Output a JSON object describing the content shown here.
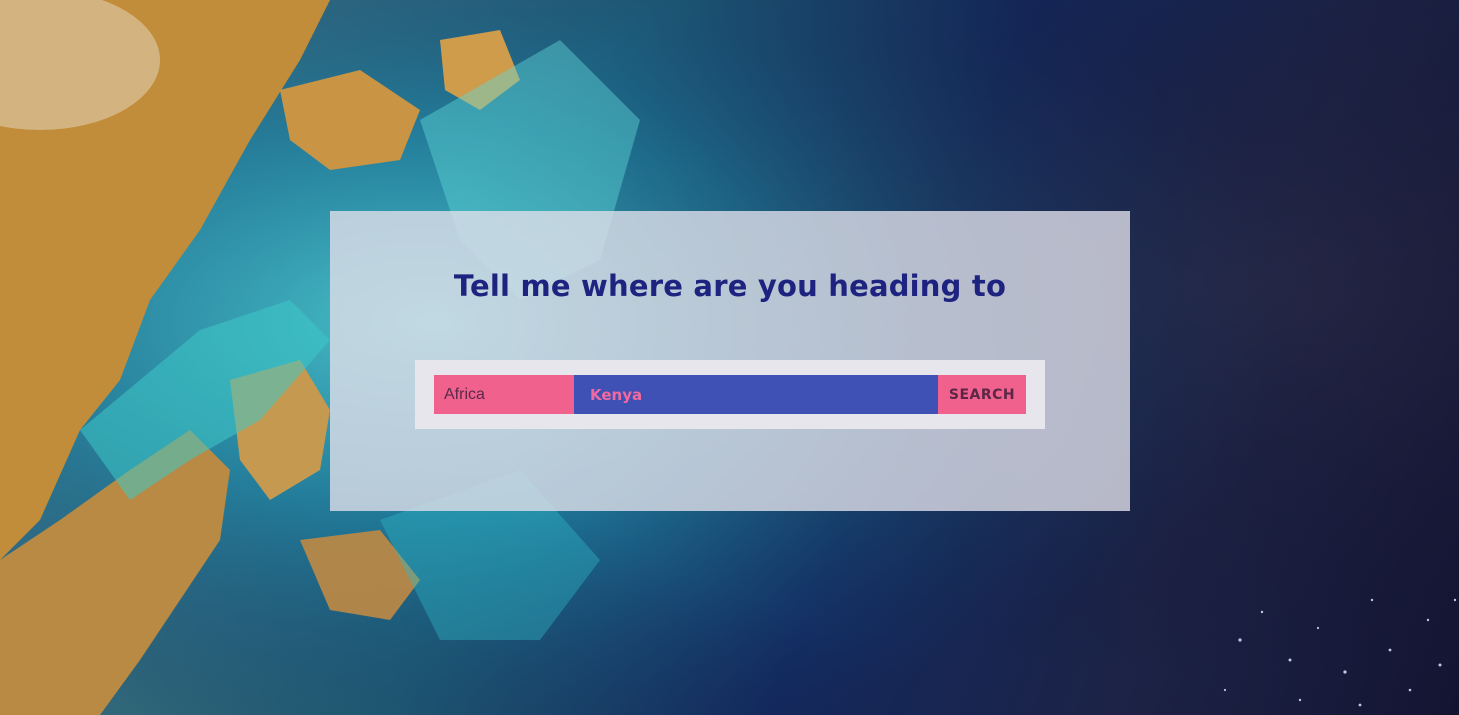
{
  "heading": "Tell me where are you heading to",
  "search": {
    "region_value": "Africa",
    "country_value": "Kenya",
    "button_label": "SEARCH"
  },
  "colors": {
    "heading": "#1f2380",
    "region_bg": "#f0618e",
    "region_text": "#5a2a4a",
    "country_bg": "#3f51b5",
    "country_text": "#f06aa0",
    "button_bg": "#f0618e",
    "button_text": "#5b2745"
  }
}
